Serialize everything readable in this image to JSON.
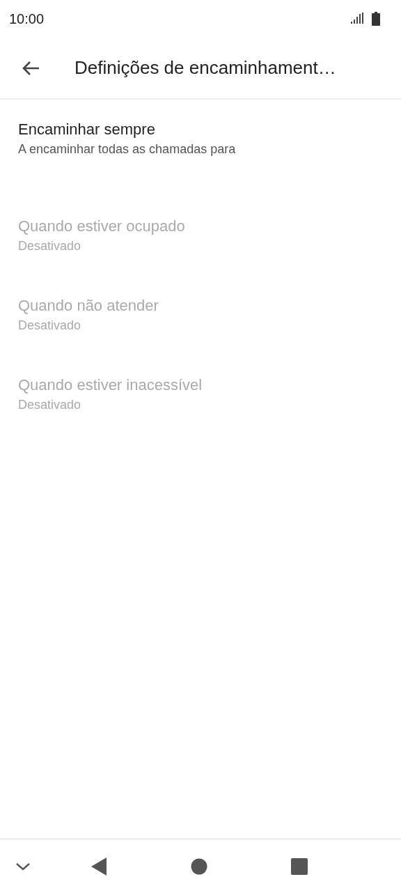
{
  "status_bar": {
    "time": "10:00"
  },
  "app_bar": {
    "title": "Definições de encaminhament…"
  },
  "items": [
    {
      "title": "Encaminhar sempre",
      "subtitle": "A encaminhar todas as chamadas para",
      "disabled": false
    },
    {
      "title": "Quando estiver ocupado",
      "subtitle": "Desativado",
      "disabled": true
    },
    {
      "title": "Quando não atender",
      "subtitle": "Desativado",
      "disabled": true
    },
    {
      "title": "Quando estiver inacessível",
      "subtitle": "Desativado",
      "disabled": true
    }
  ]
}
